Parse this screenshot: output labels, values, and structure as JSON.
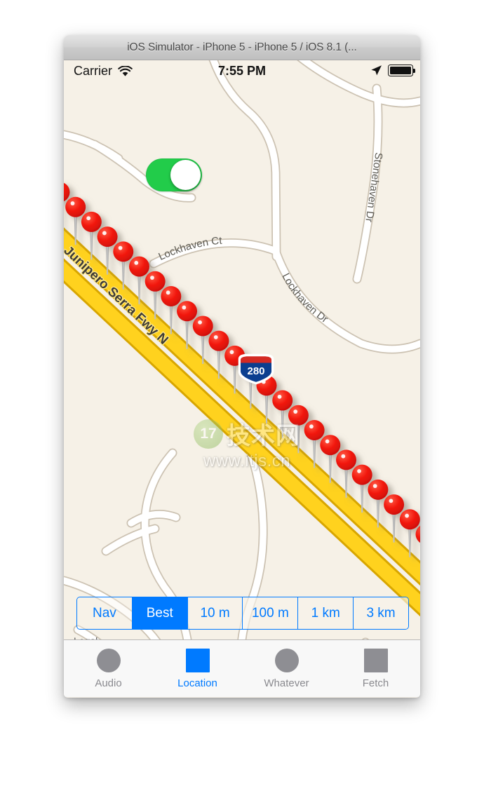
{
  "window": {
    "title": "iOS Simulator - iPhone 5 - iPhone 5 / iOS 8.1 (..."
  },
  "status_bar": {
    "carrier": "Carrier",
    "wifi_icon": "wifi-icon",
    "time": "7:55 PM",
    "location_arrow_icon": "location-arrow-icon",
    "battery_icon": "battery-full-icon"
  },
  "toggle": {
    "name": "location-tracking-toggle",
    "state": "on",
    "on_color": "#22cc4a"
  },
  "map": {
    "background_color": "#f6f1e7",
    "road_fill": "#ffffff",
    "road_stroke": "#ccc2b2",
    "freeway_fill": "#ffd21e",
    "freeway_stroke": "#d8a600",
    "labels": [
      {
        "text": "Lockhaven Ct",
        "type": "street"
      },
      {
        "text": "Lockhaven Dr",
        "type": "street"
      },
      {
        "text": "Stonehaven Dr",
        "type": "street"
      },
      {
        "text": "Junipero Serra Fwy N",
        "type": "freeway"
      }
    ],
    "highway_shield": {
      "label": "280",
      "type": "interstate",
      "shield_blue": "#0b3e8f",
      "shield_red": "#d42a23"
    },
    "pin_color": "#f01c12",
    "pin_count": 24
  },
  "watermark": {
    "logo_number": "17",
    "text_cn": "技术网",
    "url": "www.itjs.cn"
  },
  "segmented_control": {
    "name": "accuracy-segmented-control",
    "selected_index": 1,
    "segments": [
      {
        "label": "Nav"
      },
      {
        "label": "Best"
      },
      {
        "label": "10 m"
      },
      {
        "label": "100 m"
      },
      {
        "label": "1 km"
      },
      {
        "label": "3 km"
      }
    ],
    "tint_color": "#007aff"
  },
  "legal": {
    "label": "Legal"
  },
  "tab_bar": {
    "active_index": 1,
    "tabs": [
      {
        "label": "Audio",
        "icon": "circle-icon",
        "shape": "circle"
      },
      {
        "label": "Location",
        "icon": "square-icon",
        "shape": "square"
      },
      {
        "label": "Whatever",
        "icon": "circle-icon",
        "shape": "circle"
      },
      {
        "label": "Fetch",
        "icon": "square-icon",
        "shape": "square"
      }
    ],
    "active_color": "#007aff",
    "inactive_color": "#8e8e93"
  }
}
